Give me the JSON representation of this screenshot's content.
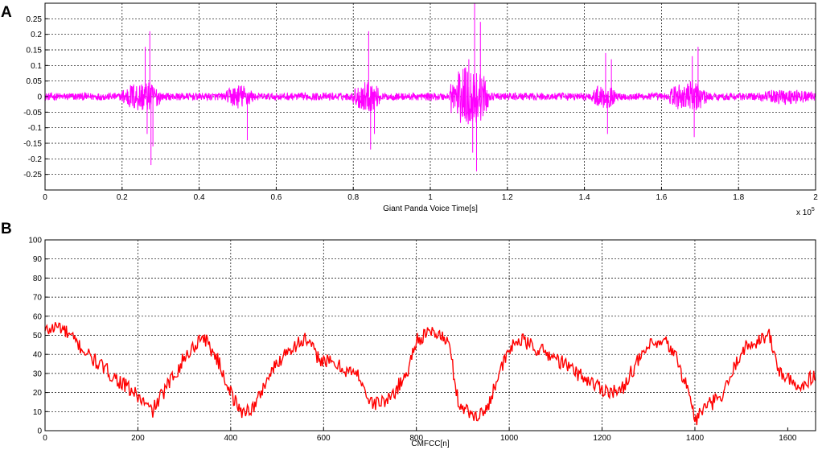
{
  "chart_data": [
    {
      "type": "line",
      "panel_label": "A",
      "xlabel": "Giant Panda Voice Time[s]",
      "x_multiplier_label": "x 10",
      "x_multiplier_exp": "5",
      "xlim": [
        0,
        200000
      ],
      "ylim": [
        -0.3,
        0.3
      ],
      "xticks": [
        0,
        20000,
        40000,
        60000,
        80000,
        100000,
        120000,
        140000,
        160000,
        180000,
        200000
      ],
      "xtick_labels": [
        "0",
        "0.2",
        "0.4",
        "0.6",
        "0.8",
        "1",
        "1.2",
        "1.4",
        "1.6",
        "1.8",
        "2"
      ],
      "yticks": [
        -0.25,
        -0.2,
        -0.15,
        -0.1,
        -0.05,
        0,
        0.05,
        0.1,
        0.15,
        0.2,
        0.25
      ],
      "ytick_labels": [
        "-0.25",
        "-0.2",
        "-0.15",
        "-0.1",
        "-0.05",
        "0",
        "0.05",
        "0.1",
        "0.15",
        "0.2",
        "0.25"
      ],
      "grid": true,
      "color": "#ff00ff",
      "baseline_amplitude": 0.012,
      "activity_segments": [
        {
          "x_start": 20000,
          "x_end": 30000,
          "amplitude": 0.05
        },
        {
          "x_start": 47000,
          "x_end": 54000,
          "amplitude": 0.04
        },
        {
          "x_start": 80000,
          "x_end": 87000,
          "amplitude": 0.05
        },
        {
          "x_start": 105000,
          "x_end": 115000,
          "amplitude": 0.1
        },
        {
          "x_start": 142000,
          "x_end": 148000,
          "amplitude": 0.04
        },
        {
          "x_start": 162000,
          "x_end": 172000,
          "amplitude": 0.05
        },
        {
          "x_start": 185000,
          "x_end": 200000,
          "amplitude": 0.025
        }
      ],
      "spikes": [
        {
          "x": 26000,
          "y": 0.16
        },
        {
          "x": 26500,
          "y": -0.12
        },
        {
          "x": 27200,
          "y": 0.21
        },
        {
          "x": 27500,
          "y": -0.22
        },
        {
          "x": 28000,
          "y": -0.16
        },
        {
          "x": 52500,
          "y": -0.14
        },
        {
          "x": 84000,
          "y": 0.21
        },
        {
          "x": 84500,
          "y": -0.17
        },
        {
          "x": 85500,
          "y": -0.12
        },
        {
          "x": 110000,
          "y": 0.12
        },
        {
          "x": 111000,
          "y": -0.18
        },
        {
          "x": 111500,
          "y": 0.3
        },
        {
          "x": 112000,
          "y": -0.24
        },
        {
          "x": 113000,
          "y": 0.24
        },
        {
          "x": 145500,
          "y": 0.14
        },
        {
          "x": 146000,
          "y": -0.12
        },
        {
          "x": 147000,
          "y": 0.12
        },
        {
          "x": 168000,
          "y": 0.13
        },
        {
          "x": 168500,
          "y": -0.13
        },
        {
          "x": 169500,
          "y": 0.16
        }
      ]
    },
    {
      "type": "line",
      "panel_label": "B",
      "xlabel": "CMFCC[n]",
      "xlim": [
        0,
        1660
      ],
      "ylim": [
        0,
        100
      ],
      "xticks": [
        0,
        200,
        400,
        600,
        800,
        1000,
        1200,
        1400,
        1600
      ],
      "xtick_labels": [
        "0",
        "200",
        "400",
        "600",
        "800",
        "1000",
        "1200",
        "1400",
        "1600"
      ],
      "yticks": [
        0,
        10,
        20,
        30,
        40,
        50,
        60,
        70,
        80,
        90,
        100
      ],
      "ytick_labels": [
        "0",
        "10",
        "20",
        "30",
        "40",
        "50",
        "60",
        "70",
        "80",
        "90",
        "100"
      ],
      "grid": true,
      "color": "#ff0000",
      "noise_amplitude": 4,
      "envelope": [
        [
          0,
          52
        ],
        [
          30,
          55
        ],
        [
          60,
          48
        ],
        [
          100,
          38
        ],
        [
          150,
          28
        ],
        [
          200,
          18
        ],
        [
          230,
          10
        ],
        [
          260,
          22
        ],
        [
          300,
          38
        ],
        [
          340,
          50
        ],
        [
          370,
          38
        ],
        [
          400,
          20
        ],
        [
          420,
          10
        ],
        [
          450,
          12
        ],
        [
          480,
          28
        ],
        [
          520,
          42
        ],
        [
          560,
          48
        ],
        [
          590,
          38
        ],
        [
          640,
          33
        ],
        [
          680,
          28
        ],
        [
          700,
          14
        ],
        [
          740,
          16
        ],
        [
          780,
          30
        ],
        [
          800,
          48
        ],
        [
          840,
          52
        ],
        [
          870,
          46
        ],
        [
          890,
          15
        ],
        [
          920,
          8
        ],
        [
          950,
          10
        ],
        [
          970,
          25
        ],
        [
          1000,
          42
        ],
        [
          1020,
          48
        ],
        [
          1060,
          43
        ],
        [
          1100,
          38
        ],
        [
          1160,
          28
        ],
        [
          1200,
          22
        ],
        [
          1240,
          20
        ],
        [
          1260,
          30
        ],
        [
          1300,
          44
        ],
        [
          1340,
          46
        ],
        [
          1360,
          38
        ],
        [
          1390,
          18
        ],
        [
          1400,
          5
        ],
        [
          1420,
          12
        ],
        [
          1460,
          18
        ],
        [
          1500,
          42
        ],
        [
          1540,
          48
        ],
        [
          1560,
          50
        ],
        [
          1580,
          32
        ],
        [
          1620,
          22
        ],
        [
          1660,
          30
        ]
      ]
    }
  ]
}
